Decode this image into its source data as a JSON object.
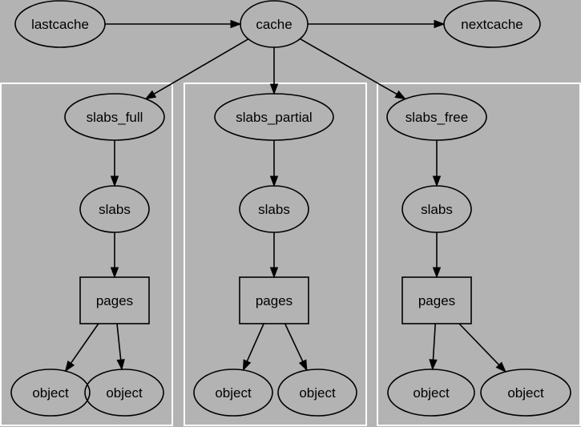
{
  "diagram": {
    "title": "",
    "background": "#b3b3b3",
    "cluster_border_color": "#ffffff",
    "nodes": [
      {
        "id": "lastcache",
        "label": "lastcache",
        "shape": "ellipse"
      },
      {
        "id": "cache",
        "label": "cache",
        "shape": "ellipse"
      },
      {
        "id": "nextcache",
        "label": "nextcache",
        "shape": "ellipse"
      },
      {
        "id": "slabs_full",
        "label": "slabs_full",
        "shape": "ellipse",
        "cluster": "full"
      },
      {
        "id": "slabs_partial",
        "label": "slabs_partial",
        "shape": "ellipse",
        "cluster": "partial"
      },
      {
        "id": "slabs_free",
        "label": "slabs_free",
        "shape": "ellipse",
        "cluster": "free"
      },
      {
        "id": "slabs1",
        "label": "slabs",
        "shape": "ellipse",
        "cluster": "full"
      },
      {
        "id": "slabs2",
        "label": "slabs",
        "shape": "ellipse",
        "cluster": "partial"
      },
      {
        "id": "slabs3",
        "label": "slabs",
        "shape": "ellipse",
        "cluster": "free"
      },
      {
        "id": "pages1",
        "label": "pages",
        "shape": "box",
        "cluster": "full"
      },
      {
        "id": "pages2",
        "label": "pages",
        "shape": "box",
        "cluster": "partial"
      },
      {
        "id": "pages3",
        "label": "pages",
        "shape": "box",
        "cluster": "free"
      },
      {
        "id": "obj1a",
        "label": "object",
        "shape": "ellipse",
        "cluster": "full"
      },
      {
        "id": "obj1b",
        "label": "object",
        "shape": "ellipse",
        "cluster": "full"
      },
      {
        "id": "obj2a",
        "label": "object",
        "shape": "ellipse",
        "cluster": "partial"
      },
      {
        "id": "obj2b",
        "label": "object",
        "shape": "ellipse",
        "cluster": "partial"
      },
      {
        "id": "obj3a",
        "label": "object",
        "shape": "ellipse",
        "cluster": "free"
      },
      {
        "id": "obj3b",
        "label": "object",
        "shape": "ellipse",
        "cluster": "free"
      }
    ],
    "edges": [
      {
        "from": "lastcache",
        "to": "cache"
      },
      {
        "from": "cache",
        "to": "nextcache"
      },
      {
        "from": "cache",
        "to": "slabs_full"
      },
      {
        "from": "cache",
        "to": "slabs_partial"
      },
      {
        "from": "cache",
        "to": "slabs_free"
      },
      {
        "from": "slabs_full",
        "to": "slabs1"
      },
      {
        "from": "slabs_partial",
        "to": "slabs2"
      },
      {
        "from": "slabs_free",
        "to": "slabs3"
      },
      {
        "from": "slabs1",
        "to": "pages1"
      },
      {
        "from": "slabs2",
        "to": "pages2"
      },
      {
        "from": "slabs3",
        "to": "pages3"
      },
      {
        "from": "pages1",
        "to": "obj1a"
      },
      {
        "from": "pages1",
        "to": "obj1b"
      },
      {
        "from": "pages2",
        "to": "obj2a"
      },
      {
        "from": "pages2",
        "to": "obj2b"
      },
      {
        "from": "pages3",
        "to": "obj3a"
      },
      {
        "from": "pages3",
        "to": "obj3b"
      }
    ],
    "clusters": [
      {
        "id": "full",
        "label": ""
      },
      {
        "id": "partial",
        "label": ""
      },
      {
        "id": "free",
        "label": ""
      }
    ]
  }
}
